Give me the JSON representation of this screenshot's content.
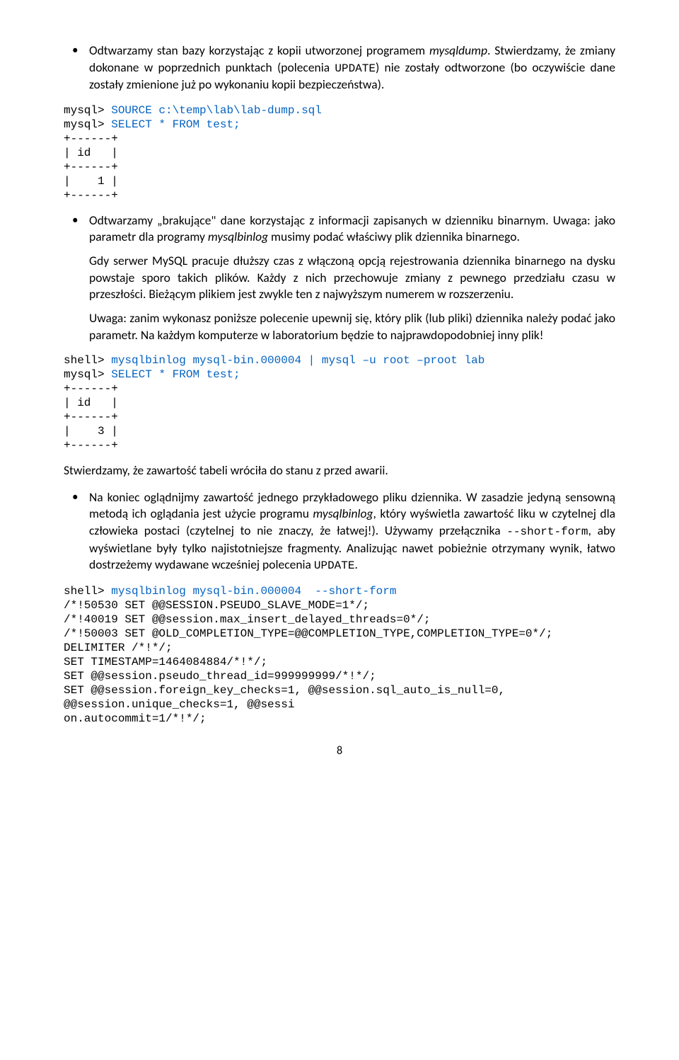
{
  "bullet1": {
    "pre": "Odtwarzamy stan bazy korzystając z kopii utworzonej programem ",
    "em": "mysqldump",
    "post1": ". Stwierdzamy, że zmiany dokonane w poprzednich punktach (polecenia ",
    "code": "UPDATE",
    "post2": ") nie zostały odtworzone (bo oczywiście dane zostały zmienione już po wykonaniu kopii bezpieczeństwa)."
  },
  "code1": {
    "prompt1": "mysql> ",
    "cmd1": "SOURCE c:\\temp\\lab\\lab-dump.sql",
    "prompt2": "mysql> ",
    "cmd2": "SELECT * FROM test;",
    "out": "+------+\n| id   |\n+------+\n|    1 |\n+------+"
  },
  "bullet2": {
    "p1a": "Odtwarzamy „brakujące\" dane korzystając z informacji zapisanych w dzienniku binarnym. Uwaga: jako parametr dla programy ",
    "em1": "mysqlbinlog",
    "p1b": " musimy podać właściwy plik dziennika binarnego.",
    "p2": "Gdy serwer MySQL pracuje dłuższy czas z włączoną opcją rejestrowania dziennika binarnego na dysku powstaje sporo takich plików. Każdy z nich przechowuje zmiany z pewnego przedziału czasu w przeszłości. Bieżącym plikiem jest zwykle ten z najwyższym numerem w rozszerzeniu.",
    "p3": "Uwaga: zanim wykonasz poniższe polecenie upewnij się, który plik (lub pliki) dziennika należy podać jako parametr. Na każdym komputerze w laboratorium będzie to najprawdopodobniej inny plik!"
  },
  "code2": {
    "prompt1": "shell> ",
    "cmd1": "mysqlbinlog mysql-bin.000004 | mysql –u root –proot lab",
    "prompt2": "mysql> ",
    "cmd2": "SELECT * FROM test;",
    "out": "+------+\n| id   |\n+------+\n|    3 |\n+------+"
  },
  "para_after": "Stwierdzamy, że zawartość tabeli wróciła do stanu z przed awarii.",
  "bullet3": {
    "a": "Na koniec oglądnijmy zawartość jednego przykładowego pliku dziennika. W zasadzie jedyną sensowną metodą ich oglądania jest użycie programu ",
    "em1": "mysqlbinlog",
    "b": ", który wyświetla zawartość liku w czytelnej dla człowieka postaci (czytelnej to nie znaczy, że łatwej!). Używamy przełącznika ",
    "code1": "--short-form",
    "c": ", aby wyświetlane były tylko najistotniejsze fragmenty. Analizując nawet pobieżnie otrzymany wynik, łatwo dostrzeżemy wydawane wcześniej polecenia ",
    "code2": "UPDATE",
    "d": "."
  },
  "code3": {
    "prompt": "shell> ",
    "cmd": "mysqlbinlog mysql-bin.000004  --short-form",
    "out": "/*!50530 SET @@SESSION.PSEUDO_SLAVE_MODE=1*/;\n/*!40019 SET @@session.max_insert_delayed_threads=0*/;\n/*!50003 SET @OLD_COMPLETION_TYPE=@@COMPLETION_TYPE,COMPLETION_TYPE=0*/;\nDELIMITER /*!*/;\nSET TIMESTAMP=1464084884/*!*/;\nSET @@session.pseudo_thread_id=999999999/*!*/;\nSET @@session.foreign_key_checks=1, @@session.sql_auto_is_null=0,\n@@session.unique_checks=1, @@sessi\non.autocommit=1/*!*/;"
  },
  "page_number": "8"
}
